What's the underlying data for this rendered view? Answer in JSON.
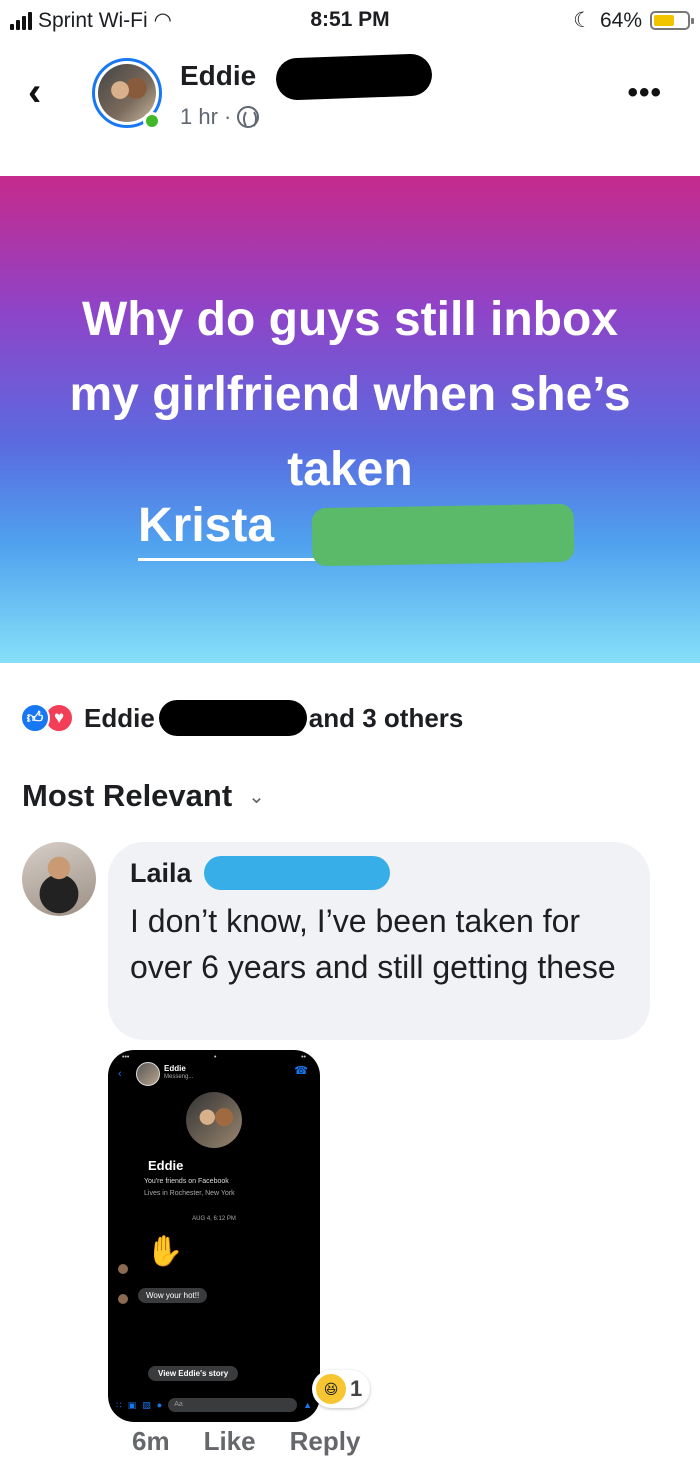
{
  "status_bar": {
    "carrier": "Sprint Wi-Fi",
    "time": "8:51 PM",
    "battery": "64%",
    "battery_level": 0.64,
    "icons": [
      "signal-icon",
      "wifi-icon",
      "moon-icon",
      "battery-icon"
    ]
  },
  "header": {
    "poster_name": "Eddie",
    "post_time": "1 hr ·",
    "icons": [
      "back-icon",
      "globe-icon",
      "more-icon"
    ]
  },
  "post": {
    "text": "Why do guys still inbox my girlfriend when she’s taken",
    "tag": "Krista",
    "colors": {
      "gradient_top": "#c62a8c",
      "gradient_mid": "#5a6be0",
      "gradient_bottom": "#86e0f8"
    }
  },
  "reactions": {
    "first_name": "Eddie",
    "suffix": "and 3 others",
    "icons": [
      "like-icon",
      "love-icon"
    ]
  },
  "sort": {
    "label": "Most Relevant"
  },
  "comment": {
    "author": "Laila",
    "text": "I don’t know, I’ve been taken for over 6 years and still getting these",
    "attachment": {
      "name": "Eddie",
      "subtitle": "Messeng...",
      "friends_line": "You're friends on Facebook",
      "lives_line": "Lives in Rochester, New York",
      "date": "AUG 4, 6:12 PM",
      "message": "Wow your hot!!",
      "story_button": "View Eddie's story",
      "input_placeholder": "Aa"
    },
    "reaction_count": "1",
    "time": "6m",
    "like_label": "Like",
    "reply_label": "Reply"
  }
}
